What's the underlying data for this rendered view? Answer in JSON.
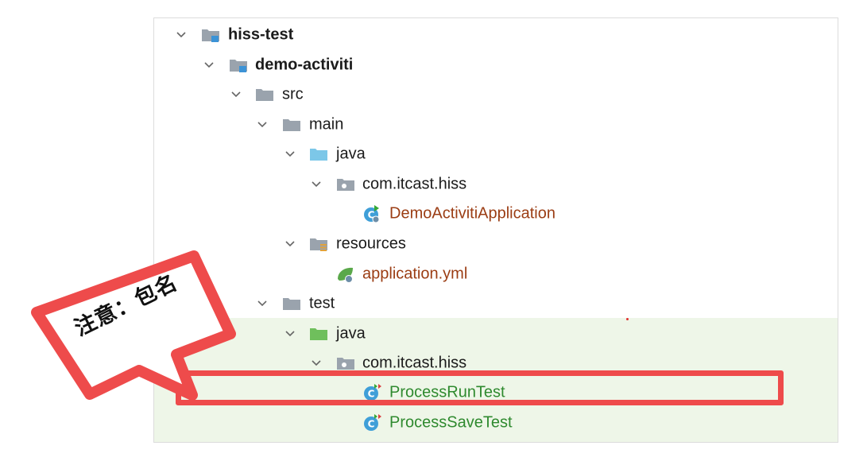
{
  "tree": {
    "root": {
      "label": "hiss-test"
    },
    "module": {
      "label": "demo-activiti"
    },
    "src": {
      "label": "src"
    },
    "main": {
      "label": "main"
    },
    "main_java": {
      "label": "java"
    },
    "main_pkg": {
      "label": "com.itcast.hiss"
    },
    "main_class": {
      "label": "DemoActivitiApplication"
    },
    "resources": {
      "label": "resources"
    },
    "app_yml": {
      "label": "application.yml"
    },
    "test": {
      "label": "test"
    },
    "test_java": {
      "label": "java"
    },
    "test_pkg": {
      "label": "com.itcast.hiss"
    },
    "test_class_1": {
      "label": "ProcessRunTest"
    },
    "test_class_2": {
      "label": "ProcessSaveTest"
    }
  },
  "annotation": {
    "text": "注意：包名"
  },
  "colors": {
    "callout_red": "#ee4b4b",
    "test_bg": "#eef6e8",
    "main_class_text": "#9b3d14",
    "test_class_text": "#2f8a2f"
  }
}
